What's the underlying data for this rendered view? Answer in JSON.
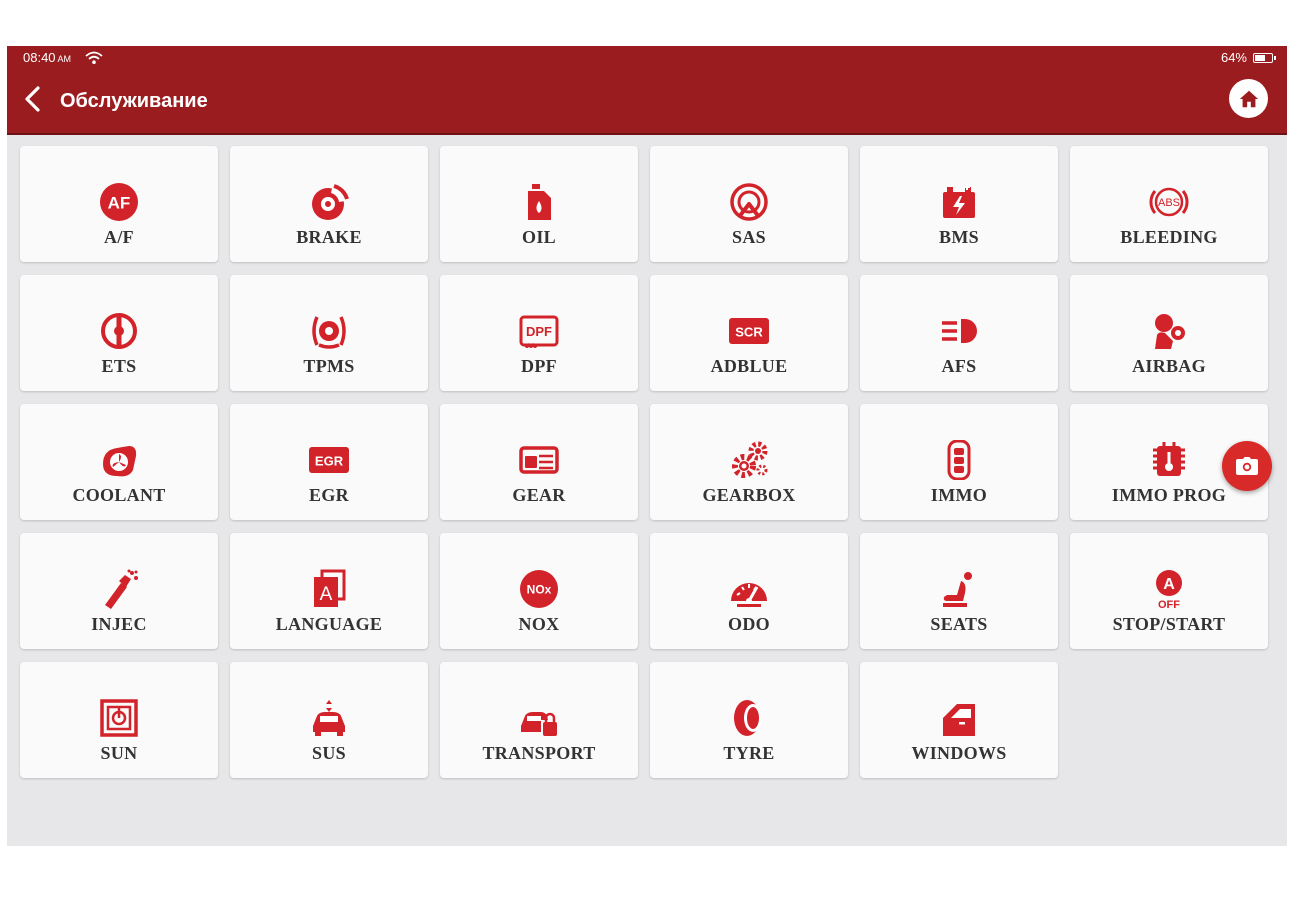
{
  "status_bar": {
    "time": "08:40",
    "ampm": "AM",
    "battery": "64%",
    "battery_level": 0.64
  },
  "app_bar": {
    "title": "Обслуживание"
  },
  "accent_color": "#9b1c1f",
  "icon_color": "#d2232a",
  "items": [
    {
      "label": "A/F",
      "icon": "af-icon"
    },
    {
      "label": "BRAKE",
      "icon": "brake-icon"
    },
    {
      "label": "OIL",
      "icon": "oil-icon"
    },
    {
      "label": "SAS",
      "icon": "sas-icon"
    },
    {
      "label": "BMS",
      "icon": "battery-icon"
    },
    {
      "label": "BLEEDING",
      "icon": "abs-icon"
    },
    {
      "label": "ETS",
      "icon": "throttle-icon"
    },
    {
      "label": "TPMS",
      "icon": "tpms-icon"
    },
    {
      "label": "DPF",
      "icon": "dpf-icon"
    },
    {
      "label": "ADBLUE",
      "icon": "scr-icon"
    },
    {
      "label": "AFS",
      "icon": "headlight-icon"
    },
    {
      "label": "AIRBAG",
      "icon": "airbag-icon"
    },
    {
      "label": "COOLANT",
      "icon": "coolant-fan-icon"
    },
    {
      "label": "EGR",
      "icon": "egr-icon"
    },
    {
      "label": "GEAR",
      "icon": "gear-learning-icon"
    },
    {
      "label": "GEARBOX",
      "icon": "gearbox-icon"
    },
    {
      "label": "IMMO",
      "icon": "key-fob-icon"
    },
    {
      "label": "IMMO PROG",
      "icon": "chip-icon"
    },
    {
      "label": "INJEC",
      "icon": "injector-icon"
    },
    {
      "label": "LANGUAGE",
      "icon": "language-icon"
    },
    {
      "label": "NOX",
      "icon": "nox-icon"
    },
    {
      "label": "ODO",
      "icon": "odometer-icon"
    },
    {
      "label": "SEATS",
      "icon": "seat-icon"
    },
    {
      "label": "STOP/START",
      "icon": "stop-start-icon"
    },
    {
      "label": "SUN",
      "icon": "sunroof-icon"
    },
    {
      "label": "SUS",
      "icon": "suspension-icon"
    },
    {
      "label": "TRANSPORT",
      "icon": "transport-mode-icon"
    },
    {
      "label": "TYRE",
      "icon": "tyre-icon"
    },
    {
      "label": "WINDOWS",
      "icon": "window-icon"
    }
  ]
}
